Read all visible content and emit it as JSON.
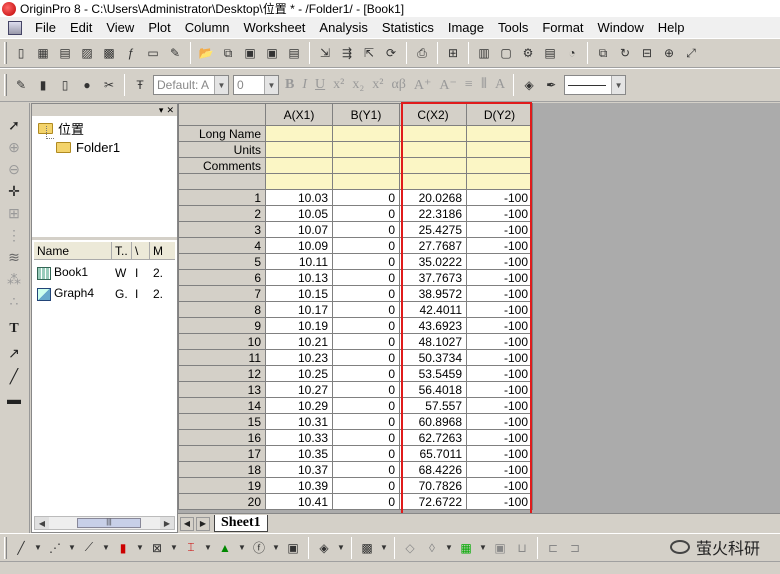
{
  "window": {
    "title": "OriginPro 8 - C:\\Users\\Administrator\\Desktop\\位置 * - /Folder1/ - [Book1]"
  },
  "menu": [
    "File",
    "Edit",
    "View",
    "Plot",
    "Column",
    "Worksheet",
    "Analysis",
    "Statistics",
    "Image",
    "Tools",
    "Format",
    "Window",
    "Help"
  ],
  "format_toolbar": {
    "font_value": "Default: A",
    "size_value": "0"
  },
  "explorer": {
    "root": "位置",
    "folder": "Folder1",
    "columns": [
      "Name",
      "T..",
      "\\",
      "M"
    ],
    "items": [
      {
        "name": "Book1",
        "type": "W",
        "v": "I",
        "m": "2."
      },
      {
        "name": "Graph4",
        "type": "G.",
        "v": "I",
        "m": "2."
      }
    ]
  },
  "worksheet": {
    "columns": [
      "A(X1)",
      "B(Y1)",
      "C(X2)",
      "D(Y2)"
    ],
    "meta_labels": [
      "Long Name",
      "Units",
      "Comments"
    ],
    "rows": [
      {
        "n": "1",
        "a": "10.03",
        "b": "0",
        "c": "20.0268",
        "d": "-100"
      },
      {
        "n": "2",
        "a": "10.05",
        "b": "0",
        "c": "22.3186",
        "d": "-100"
      },
      {
        "n": "3",
        "a": "10.07",
        "b": "0",
        "c": "25.4275",
        "d": "-100"
      },
      {
        "n": "4",
        "a": "10.09",
        "b": "0",
        "c": "27.7687",
        "d": "-100"
      },
      {
        "n": "5",
        "a": "10.11",
        "b": "0",
        "c": "35.0222",
        "d": "-100"
      },
      {
        "n": "6",
        "a": "10.13",
        "b": "0",
        "c": "37.7673",
        "d": "-100"
      },
      {
        "n": "7",
        "a": "10.15",
        "b": "0",
        "c": "38.9572",
        "d": "-100"
      },
      {
        "n": "8",
        "a": "10.17",
        "b": "0",
        "c": "42.4011",
        "d": "-100"
      },
      {
        "n": "9",
        "a": "10.19",
        "b": "0",
        "c": "43.6923",
        "d": "-100"
      },
      {
        "n": "10",
        "a": "10.21",
        "b": "0",
        "c": "48.1027",
        "d": "-100"
      },
      {
        "n": "11",
        "a": "10.23",
        "b": "0",
        "c": "50.3734",
        "d": "-100"
      },
      {
        "n": "12",
        "a": "10.25",
        "b": "0",
        "c": "53.5459",
        "d": "-100"
      },
      {
        "n": "13",
        "a": "10.27",
        "b": "0",
        "c": "56.4018",
        "d": "-100"
      },
      {
        "n": "14",
        "a": "10.29",
        "b": "0",
        "c": "57.557",
        "d": "-100"
      },
      {
        "n": "15",
        "a": "10.31",
        "b": "0",
        "c": "60.8968",
        "d": "-100"
      },
      {
        "n": "16",
        "a": "10.33",
        "b": "0",
        "c": "62.7263",
        "d": "-100"
      },
      {
        "n": "17",
        "a": "10.35",
        "b": "0",
        "c": "65.7011",
        "d": "-100"
      },
      {
        "n": "18",
        "a": "10.37",
        "b": "0",
        "c": "68.4226",
        "d": "-100"
      },
      {
        "n": "19",
        "a": "10.39",
        "b": "0",
        "c": "70.7826",
        "d": "-100"
      },
      {
        "n": "20",
        "a": "10.41",
        "b": "0",
        "c": "72.6722",
        "d": "-100"
      }
    ]
  },
  "sheet_tab": "Sheet1",
  "watermark": "萤火科研",
  "colors": {
    "highlight_box": "#e01b1b",
    "meta_fill": "#fbf6c5"
  }
}
